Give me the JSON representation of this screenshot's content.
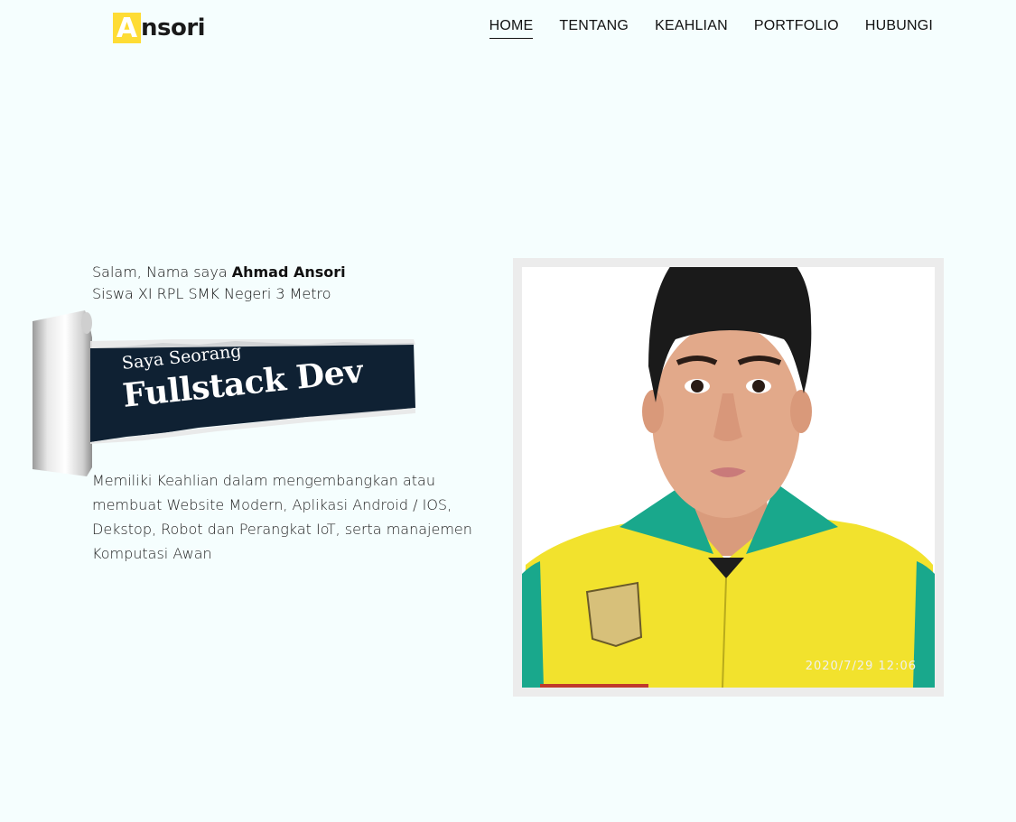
{
  "header": {
    "logo_initial": "A",
    "logo_rest": "nsori",
    "nav": [
      {
        "label": "HOME",
        "active": true
      },
      {
        "label": "TENTANG",
        "active": false
      },
      {
        "label": "KEAHLIAN",
        "active": false
      },
      {
        "label": "PORTFOLIO",
        "active": false
      },
      {
        "label": "HUBUNGI",
        "active": false
      }
    ]
  },
  "hero": {
    "greeting_prefix": "Salam, Nama saya ",
    "name": "Ahmad Ansori",
    "subtitle": "Siswa XI RPL SMK Negeri 3 Metro",
    "banner_small": "Saya Seorang",
    "banner_big": "Fullstack Dev",
    "description": "Memiliki Keahlian dalam mengembangkan atau membuat Website Modern, Aplikasi Android / IOS, Dekstop, Robot dan Perangkat IoT, serta manajemen Komputasi Awan"
  },
  "photo": {
    "timestamp": "2020/7/29  12:06"
  },
  "colors": {
    "background": "#f5fefe",
    "logo_yellow": "#fedc35",
    "banner_navy": "#0f2133",
    "frame_gray": "#ececec",
    "shirt_yellow": "#f2e22d",
    "collar_teal": "#19a88c"
  }
}
